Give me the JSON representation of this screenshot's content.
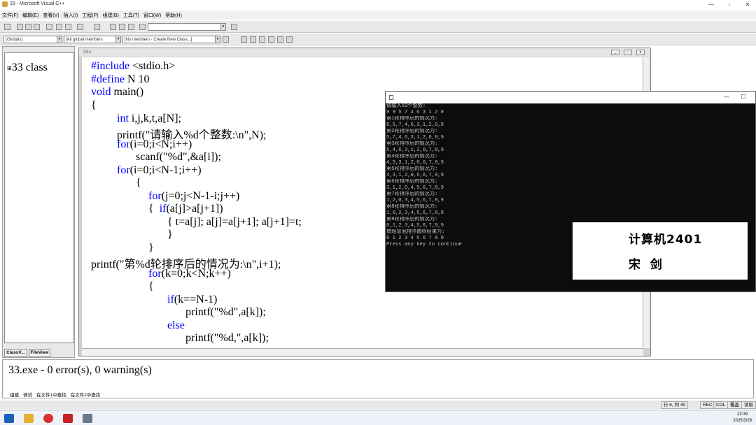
{
  "window": {
    "title": "33 - Microsoft Visual C++"
  },
  "menu": [
    "文件(F)",
    "编辑(E)",
    "查看(V)",
    "插入(I)",
    "工程(P)",
    "组建(B)",
    "工具(T)",
    "窗口(W)",
    "帮助(H)"
  ],
  "toolbar": {
    "globals_combo": "(Globals)",
    "members_combo": "[All global members",
    "class_combo": "[No members - Create New Class...]"
  },
  "left_pane": {
    "tree_root": "33 class",
    "tab_classview": "ClassV...",
    "tab_fileview": "FileView"
  },
  "editor": {
    "title": "33.c",
    "lines": [
      "#include <stdio.h>",
      "#define N 10",
      "void main()",
      "{",
      "int i,j,k,t,a[N];",
      "printf(\"请输入%d个整数:\\n\",N);",
      "for(i=0;i<N;i++)",
      "scanf(\"%d\",&a[i]);",
      "for(i=0;i<N-1;i++)",
      "{",
      "for(j=0;j<N-1-i;j++)",
      "{  if(a[j]>a[j+1])",
      "{  t=a[j]; a[j]=a[j+1]; a[j+1]=t;",
      "}",
      "}",
      "printf(\"第%d轮排序后的情况为:\\n\",i+1);",
      "for(k=0;k<N;k++)",
      "{",
      "if(k==N-1)",
      "printf(\"%d\",a[k]);",
      "else",
      "printf(\"%d,\",a[k]);"
    ]
  },
  "output": {
    "message": "33.exe - 0 error(s), 0 warning(s)",
    "tabs": [
      "组建",
      "调试",
      "在文件1中查找",
      "在文件2中查找"
    ]
  },
  "statusbar": {
    "position": "行 6, 列 40",
    "rec": "REC",
    "col": "COL",
    "ovr": "覆盖",
    "read": "读取"
  },
  "console": {
    "lines": [
      "请输入10个整数:",
      "8 9 5 7 4 6 3 1 2 0",
      "第1轮排序后的情况为:",
      "8,5,7,4,6,3,1,2,0,9",
      "第2轮排序后的情况为:",
      "5,7,4,6,3,1,2,0,8,9",
      "第3轮排序后的情况为:",
      "5,4,6,3,1,2,0,7,8,9",
      "第4轮排序后的情况为:",
      "4,5,3,1,2,0,6,7,8,9",
      "第5轮排序后的情况为:",
      "4,3,1,2,0,5,6,7,8,9",
      "第6轮排序后的情况为:",
      "3,1,2,0,4,5,6,7,8,9",
      "第7轮排序后的情况为:",
      "1,2,0,3,4,5,6,7,8,9",
      "第8轮排序后的情况为:",
      "1,0,2,3,4,5,6,7,8,9",
      "第9轮排序后的情况为:",
      "0,1,2,3,4,5,6,7,8,9",
      "数组冒泡排序最终结果为:",
      "0 1 2 3 4 5 6 7 8 9",
      "Press any key to continue"
    ]
  },
  "card": {
    "line1": "计算机2401",
    "line2": "宋 剑"
  },
  "taskbar": {
    "time": "22:39",
    "date": "2025/3/26"
  }
}
